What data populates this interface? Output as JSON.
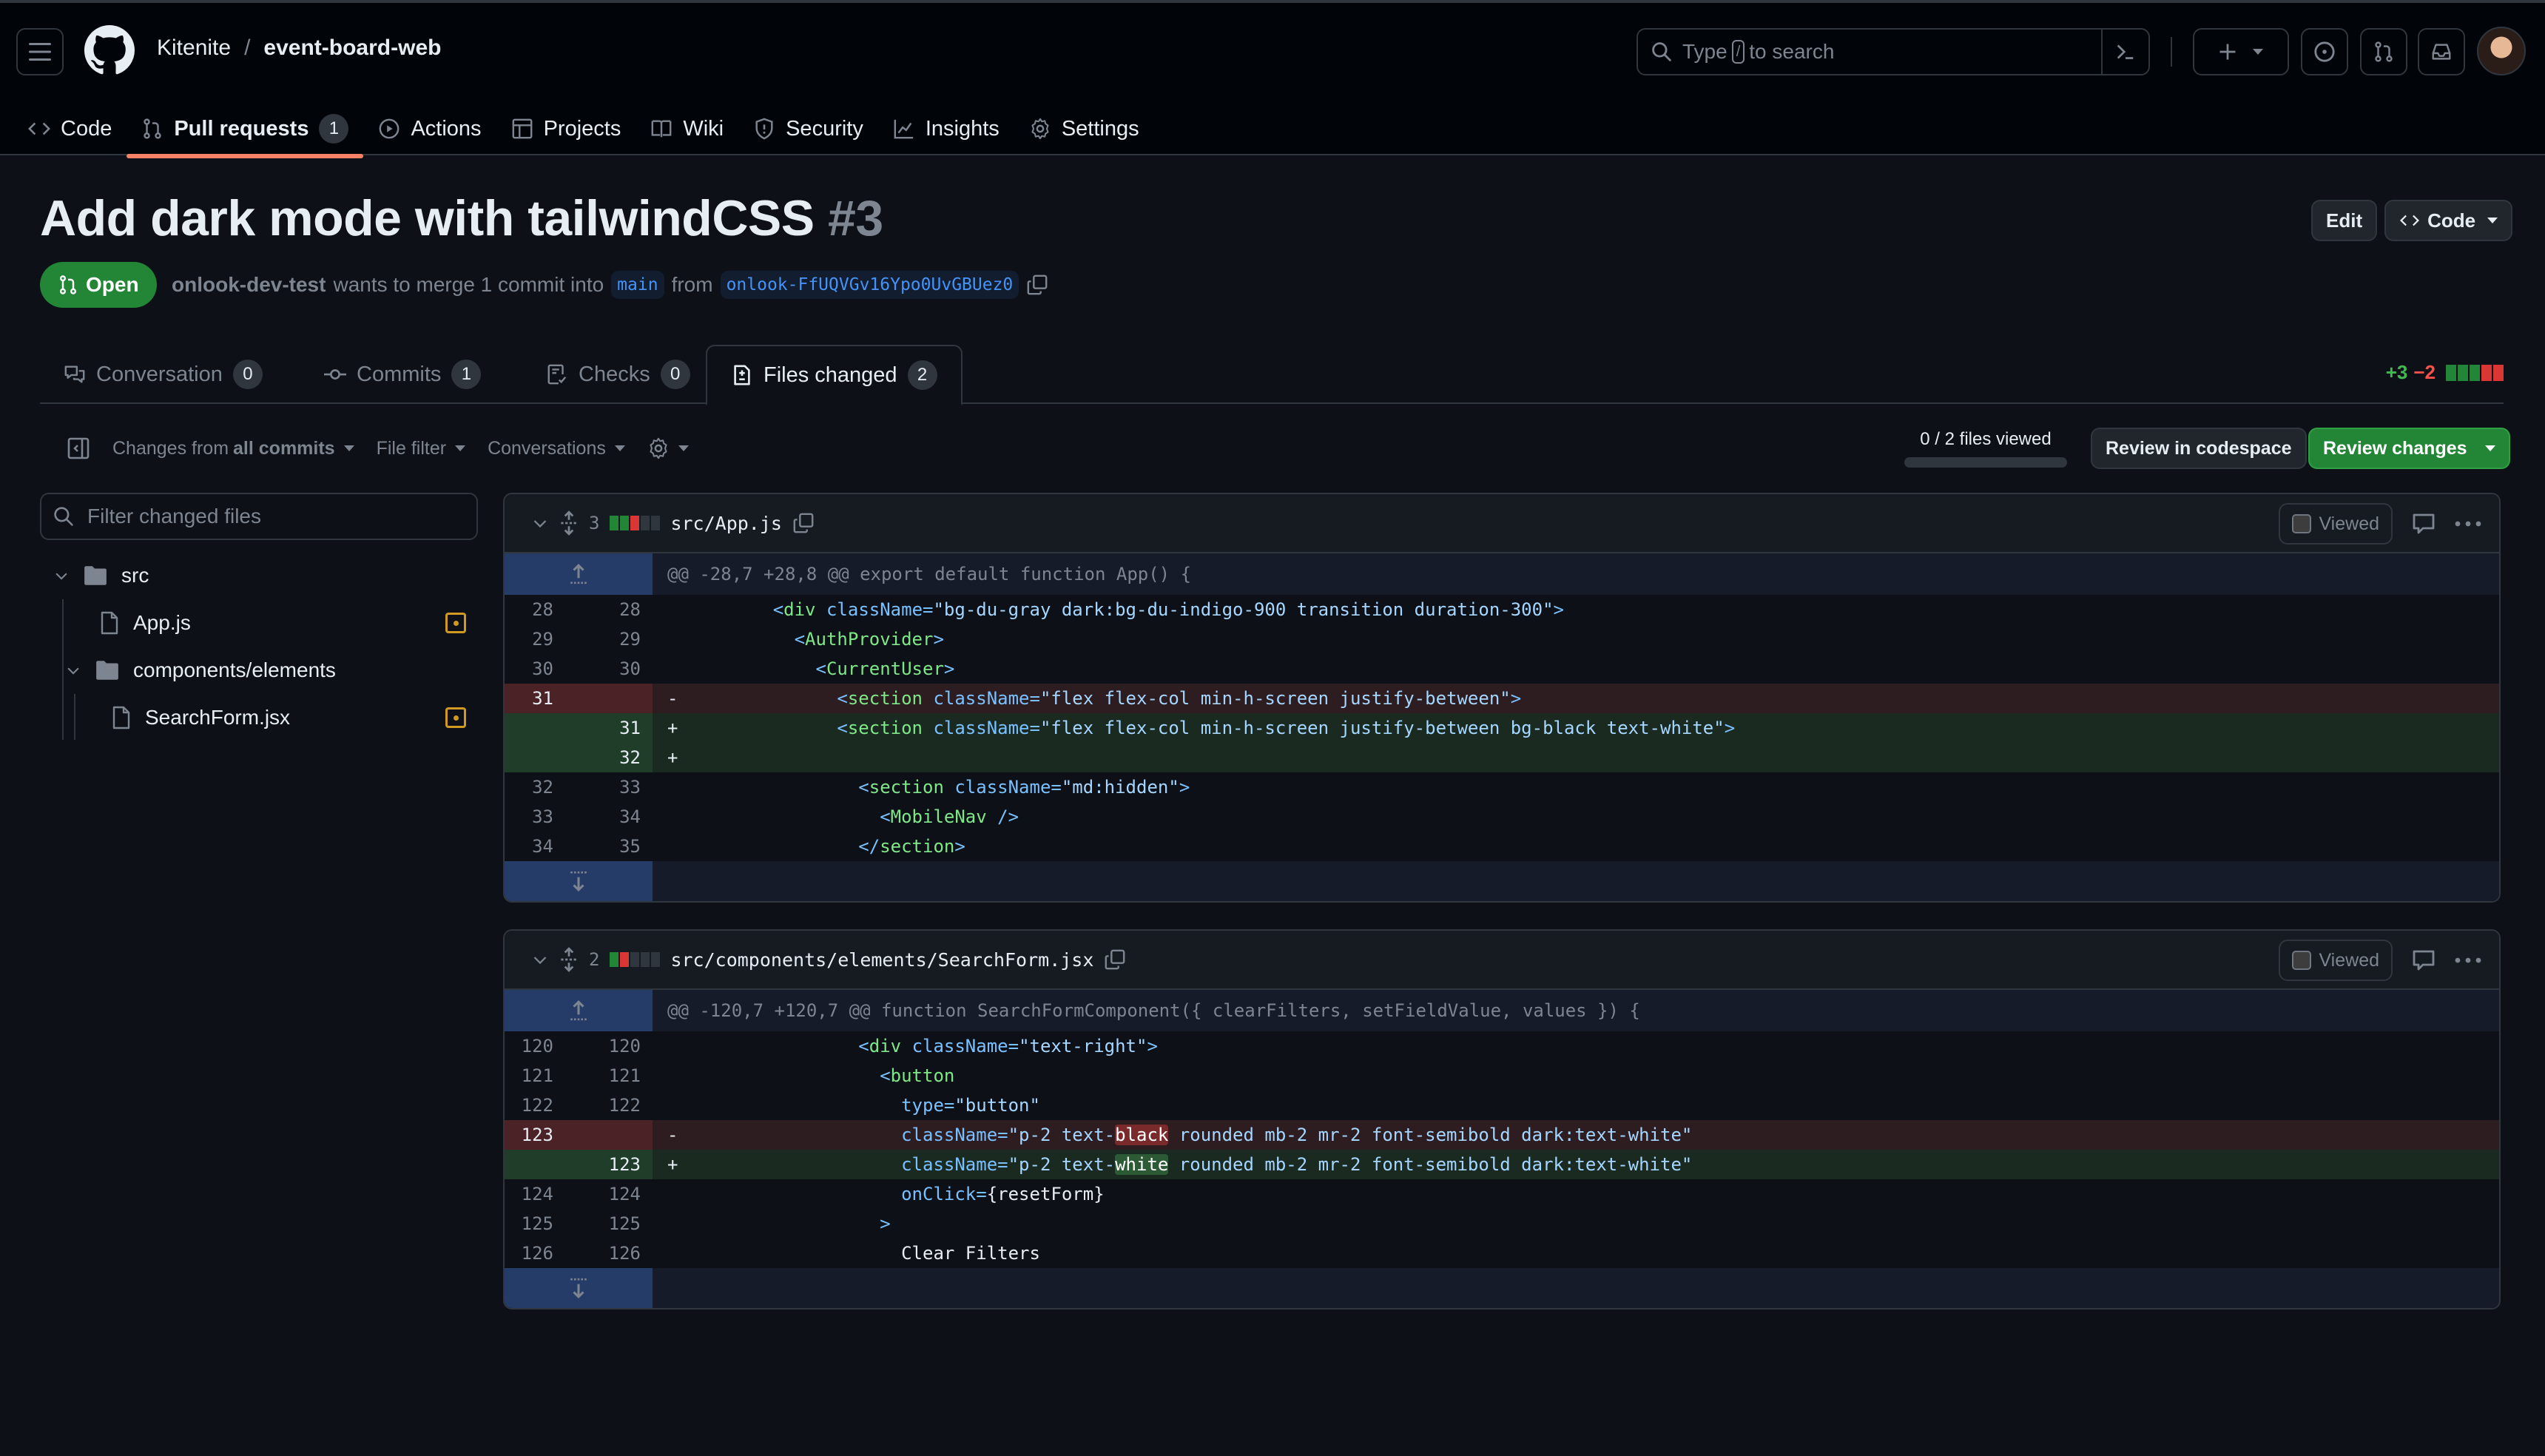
{
  "header": {
    "owner": "Kitenite",
    "separator": "/",
    "repo": "event-board-web",
    "search": {
      "prefix": "Type",
      "key": "/",
      "suffix": "to search"
    }
  },
  "repo_nav": [
    {
      "label": "Code",
      "icon": "code-icon"
    },
    {
      "label": "Pull requests",
      "icon": "git-pull-request-icon",
      "count": "1",
      "active": true
    },
    {
      "label": "Actions",
      "icon": "play-icon"
    },
    {
      "label": "Projects",
      "icon": "table-icon"
    },
    {
      "label": "Wiki",
      "icon": "book-icon"
    },
    {
      "label": "Security",
      "icon": "shield-icon"
    },
    {
      "label": "Insights",
      "icon": "graph-icon"
    },
    {
      "label": "Settings",
      "icon": "gear-icon"
    }
  ],
  "pr": {
    "title": "Add dark mode with tailwindCSS",
    "number": "#3",
    "state": "Open",
    "author": "onlook-dev-test",
    "meta_text": "wants to merge 1 commit into",
    "base_branch": "main",
    "from_text": "from",
    "head_branch": "onlook-FfUQVGv16Ypo0UvGBUez0",
    "edit_label": "Edit",
    "code_label": "Code"
  },
  "tabs": [
    {
      "label": "Conversation",
      "count": "0",
      "icon": "comment-discussion-icon"
    },
    {
      "label": "Commits",
      "count": "1",
      "icon": "git-commit-icon"
    },
    {
      "label": "Checks",
      "count": "0",
      "icon": "checklist-icon"
    },
    {
      "label": "Files changed",
      "count": "2",
      "icon": "file-diff-icon",
      "active": true
    }
  ],
  "diffstat": {
    "additions": "+3",
    "deletions": "−2",
    "blocks": [
      "add",
      "add",
      "add",
      "del",
      "del"
    ]
  },
  "toolbar": {
    "changes_prefix": "Changes from",
    "changes_value": "all commits",
    "file_filter": "File filter",
    "conversations": "Conversations",
    "files_viewed": "0 / 2 files viewed",
    "files_viewed_fraction": 0,
    "review_codespace": "Review in codespace",
    "review_changes": "Review changes"
  },
  "file_tree": {
    "filter_placeholder": "Filter changed files",
    "items": [
      {
        "type": "folder",
        "name": "src"
      },
      {
        "type": "file",
        "name": "App.js",
        "status": "modified"
      },
      {
        "type": "folder",
        "name": "components/elements"
      },
      {
        "type": "file",
        "name": "SearchForm.jsx",
        "status": "modified"
      }
    ]
  },
  "files": [
    {
      "changes": "3",
      "blocks": [
        "add",
        "add",
        "del",
        "neutral",
        "neutral"
      ],
      "path": "src/App.js",
      "viewed_label": "Viewed",
      "hunk": "@@ -28,7 +28,8 @@ export default function App() {",
      "lines": [
        {
          "type": "ctx",
          "old": "28",
          "new": "28",
          "indent": "      ",
          "html": "<span class=\"t-punc\">&lt;</span><span class=\"t-tag\">div</span> <span class=\"t-attr\">className</span><span class=\"t-punc\">=</span><span class=\"t-str\">\"bg-du-gray dark:bg-du-indigo-900 transition duration-300\"</span><span class=\"t-punc\">&gt;</span>"
        },
        {
          "type": "ctx",
          "old": "29",
          "new": "29",
          "indent": "        ",
          "html": "<span class=\"t-punc\">&lt;</span><span class=\"t-tag\">AuthProvider</span><span class=\"t-punc\">&gt;</span>"
        },
        {
          "type": "ctx",
          "old": "30",
          "new": "30",
          "indent": "          ",
          "html": "<span class=\"t-punc\">&lt;</span><span class=\"t-tag\">CurrentUser</span><span class=\"t-punc\">&gt;</span>"
        },
        {
          "type": "del",
          "old": "31",
          "new": "",
          "indent": "            ",
          "html": "<span class=\"t-punc\">&lt;</span><span class=\"t-tag\">section</span> <span class=\"t-attr\">className</span><span class=\"t-punc\">=</span><span class=\"t-str\">\"flex flex-col min-h-screen justify-between\"</span><span class=\"t-punc\">&gt;</span>"
        },
        {
          "type": "add",
          "old": "",
          "new": "31",
          "indent": "            ",
          "html": "<span class=\"t-punc\">&lt;</span><span class=\"t-tag\">section</span> <span class=\"t-attr\">className</span><span class=\"t-punc\">=</span><span class=\"t-str\">\"flex flex-col min-h-screen justify-between bg-black text-white\"</span><span class=\"t-punc\">&gt;</span>"
        },
        {
          "type": "add",
          "old": "",
          "new": "32",
          "indent": "",
          "html": ""
        },
        {
          "type": "ctx",
          "old": "32",
          "new": "33",
          "indent": "              ",
          "html": "<span class=\"t-punc\">&lt;</span><span class=\"t-tag\">section</span> <span class=\"t-attr\">className</span><span class=\"t-punc\">=</span><span class=\"t-str\">\"md:hidden\"</span><span class=\"t-punc\">&gt;</span>"
        },
        {
          "type": "ctx",
          "old": "33",
          "new": "34",
          "indent": "                ",
          "html": "<span class=\"t-punc\">&lt;</span><span class=\"t-tag\">MobileNav</span> <span class=\"t-punc\">/&gt;</span>"
        },
        {
          "type": "ctx",
          "old": "34",
          "new": "35",
          "indent": "              ",
          "html": "<span class=\"t-punc\">&lt;/</span><span class=\"t-tag\">section</span><span class=\"t-punc\">&gt;</span>"
        }
      ]
    },
    {
      "changes": "2",
      "blocks": [
        "add",
        "del",
        "neutral",
        "neutral",
        "neutral"
      ],
      "path": "src/components/elements/SearchForm.jsx",
      "viewed_label": "Viewed",
      "hunk": "@@ -120,7 +120,7 @@ function SearchFormComponent({ clearFilters, setFieldValue, values }) {",
      "lines": [
        {
          "type": "ctx",
          "old": "120",
          "new": "120",
          "indent": "              ",
          "html": "<span class=\"t-punc\">&lt;</span><span class=\"t-tag\">div</span> <span class=\"t-attr\">className</span><span class=\"t-punc\">=</span><span class=\"t-str\">\"text-right\"</span><span class=\"t-punc\">&gt;</span>"
        },
        {
          "type": "ctx",
          "old": "121",
          "new": "121",
          "indent": "                ",
          "html": "<span class=\"t-punc\">&lt;</span><span class=\"t-tag\">button</span>"
        },
        {
          "type": "ctx",
          "old": "122",
          "new": "122",
          "indent": "                  ",
          "html": "<span class=\"t-attr\">type</span><span class=\"t-punc\">=</span><span class=\"t-str\">\"button\"</span>"
        },
        {
          "type": "del",
          "old": "123",
          "new": "",
          "indent": "                  ",
          "html": "<span class=\"t-attr\">className</span><span class=\"t-punc\">=</span><span class=\"t-str\">\"p-2 text-<span class=\"hl-del\">black</span> rounded mb-2 mr-2 font-semibold dark:text-white\"</span>"
        },
        {
          "type": "add",
          "old": "",
          "new": "123",
          "indent": "                  ",
          "html": "<span class=\"t-attr\">className</span><span class=\"t-punc\">=</span><span class=\"t-str\">\"p-2 text-<span class=\"hl-add\">white</span> rounded mb-2 mr-2 font-semibold dark:text-white\"</span>"
        },
        {
          "type": "ctx",
          "old": "124",
          "new": "124",
          "indent": "                  ",
          "html": "<span class=\"t-attr\">onClick</span><span class=\"t-punc\">=</span><span class=\"t-txt\">{resetForm}</span>"
        },
        {
          "type": "ctx",
          "old": "125",
          "new": "125",
          "indent": "                ",
          "html": "<span class=\"t-punc\">&gt;</span>"
        },
        {
          "type": "ctx",
          "old": "126",
          "new": "126",
          "indent": "                  ",
          "html": "<span class=\"t-txt\">Clear Filters</span>"
        }
      ]
    }
  ],
  "colors": {
    "accent_underline": "#f78166",
    "open_green": "#238636",
    "add": "#3fb950",
    "del": "#f85149",
    "modified": "#d29922",
    "link": "#4493f8"
  }
}
